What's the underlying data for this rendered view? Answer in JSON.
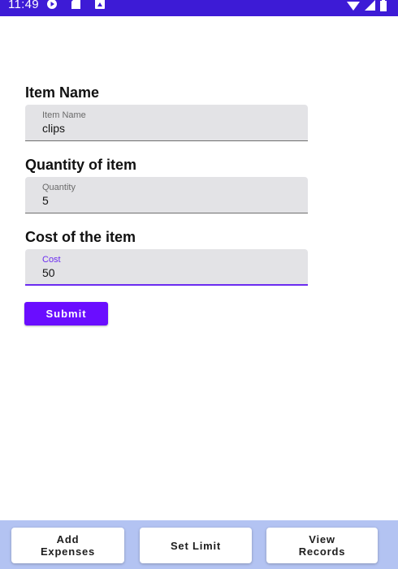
{
  "status_bar": {
    "time": "11:49",
    "bg_color": "#3d1bd6",
    "icons": [
      "play-icon",
      "sd-card-icon",
      "notification-icon",
      "wifi-icon",
      "signal-icon",
      "battery-icon"
    ]
  },
  "form": {
    "item_name": {
      "title": "Item Name",
      "label": "Item Name",
      "value": "clips"
    },
    "quantity": {
      "title": "Quantity of item",
      "label": "Quantity",
      "value": "5"
    },
    "cost": {
      "title": "Cost of the item",
      "label": "Cost",
      "value": "50",
      "focused": true
    },
    "submit_label": "Submit",
    "accent_color": "#6a0dff"
  },
  "bottom_bar": {
    "bg_color": "#b3c3f2",
    "buttons": [
      {
        "label": "Add\nExpenses"
      },
      {
        "label": "Set Limit"
      },
      {
        "label": "View\nRecords"
      }
    ]
  }
}
